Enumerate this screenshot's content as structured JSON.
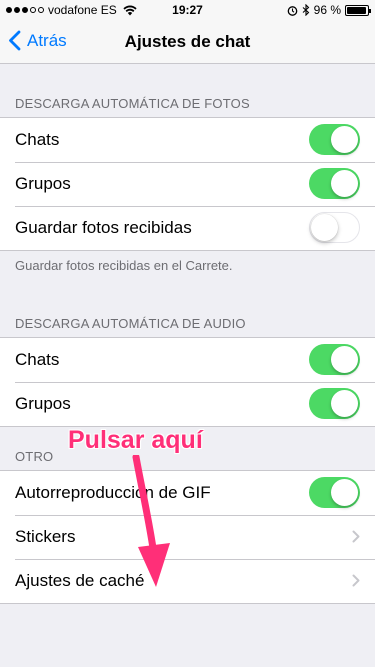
{
  "status_bar": {
    "carrier": "vodafone ES",
    "time": "19:27",
    "battery": "96 %",
    "battery_level": 0.96
  },
  "nav": {
    "back_label": "Atrás",
    "title": "Ajustes de chat"
  },
  "sections": {
    "photos": {
      "header": "DESCARGA AUTOMÁTICA DE FOTOS",
      "rows": [
        {
          "label": "Chats",
          "toggle": "on"
        },
        {
          "label": "Grupos",
          "toggle": "on"
        },
        {
          "label": "Guardar fotos recibidas",
          "toggle": "off"
        }
      ],
      "footer": "Guardar fotos recibidas en el Carrete."
    },
    "audio": {
      "header": "DESCARGA AUTOMÁTICA DE AUDIO",
      "rows": [
        {
          "label": "Chats",
          "toggle": "on"
        },
        {
          "label": "Grupos",
          "toggle": "on"
        }
      ]
    },
    "other": {
      "header": "OTRO",
      "rows": [
        {
          "label": "Autorreproducción de GIF",
          "toggle": "on"
        },
        {
          "label": "Stickers",
          "accessory": "chevron-right-icon"
        },
        {
          "label": "Ajustes de caché",
          "accessory": "chevron-right-icon"
        }
      ]
    }
  },
  "annotation": {
    "text": "Pulsar aquí",
    "color": "#ff2f78"
  },
  "colors": {
    "accent": "#007aff",
    "switch_on": "#4cd964",
    "background": "#efeff4"
  }
}
